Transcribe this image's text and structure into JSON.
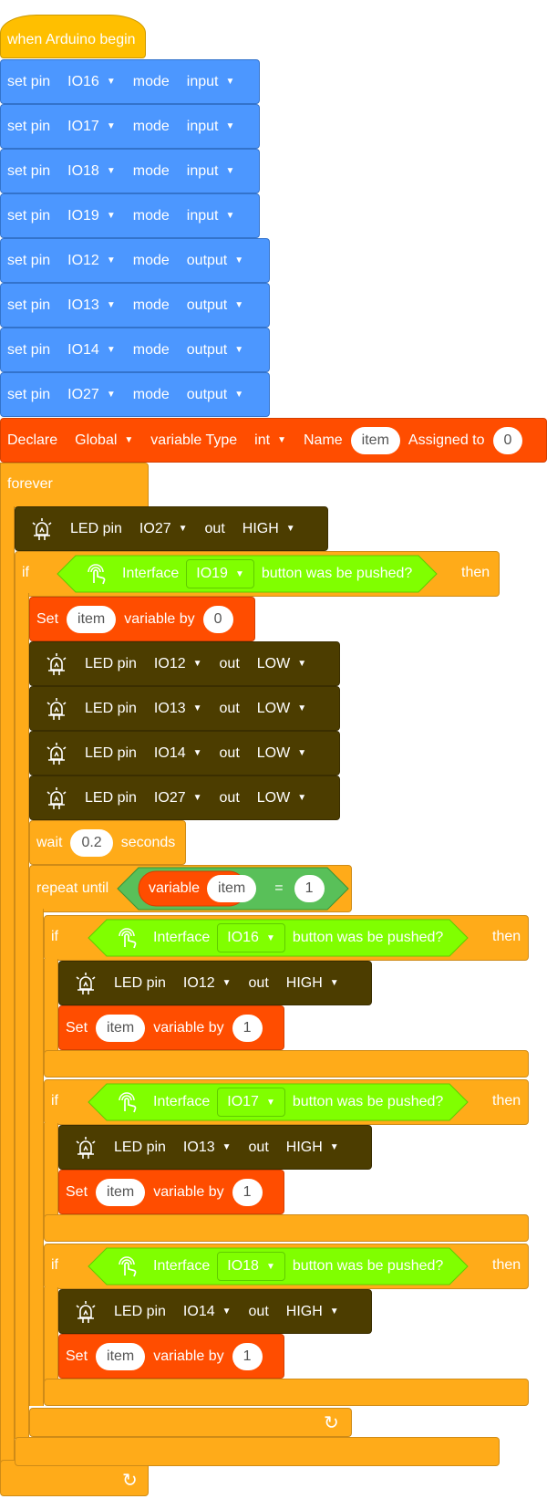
{
  "hat": {
    "label": "when Arduino begin"
  },
  "pin_modes": [
    {
      "label": "set pin",
      "pin": "IO16",
      "mode_label": "mode",
      "mode": "input"
    },
    {
      "label": "set pin",
      "pin": "IO17",
      "mode_label": "mode",
      "mode": "input"
    },
    {
      "label": "set pin",
      "pin": "IO18",
      "mode_label": "mode",
      "mode": "input"
    },
    {
      "label": "set pin",
      "pin": "IO19",
      "mode_label": "mode",
      "mode": "input"
    },
    {
      "label": "set pin",
      "pin": "IO12",
      "mode_label": "mode",
      "mode": "output"
    },
    {
      "label": "set pin",
      "pin": "IO13",
      "mode_label": "mode",
      "mode": "output"
    },
    {
      "label": "set pin",
      "pin": "IO14",
      "mode_label": "mode",
      "mode": "output"
    },
    {
      "label": "set pin",
      "pin": "IO27",
      "mode_label": "mode",
      "mode": "output"
    }
  ],
  "declare": {
    "label": "Declare",
    "scope": "Global",
    "type_label": "variable Type",
    "type": "int",
    "name_label": "Name",
    "name": "item",
    "assign_label": "Assigned to",
    "value": "0"
  },
  "forever": {
    "label": "forever"
  },
  "led_top": {
    "label": "LED pin",
    "pin": "IO27",
    "out_label": "out",
    "level": "HIGH"
  },
  "if_main": {
    "if": "if",
    "iface": "Interface",
    "pin": "IO19",
    "suffix": "button was be pushed?",
    "then": "then"
  },
  "set_main": {
    "label": "Set",
    "var": "item",
    "mid": "variable by",
    "value": "0"
  },
  "leds_low": [
    {
      "label": "LED pin",
      "pin": "IO12",
      "out_label": "out",
      "level": "LOW"
    },
    {
      "label": "LED pin",
      "pin": "IO13",
      "out_label": "out",
      "level": "LOW"
    },
    {
      "label": "LED pin",
      "pin": "IO14",
      "out_label": "out",
      "level": "LOW"
    },
    {
      "label": "LED pin",
      "pin": "IO27",
      "out_label": "out",
      "level": "LOW"
    }
  ],
  "wait": {
    "label": "wait",
    "value": "0.2",
    "unit": "seconds"
  },
  "repeat": {
    "label": "repeat until",
    "var_label": "variable",
    "var": "item",
    "op": "=",
    "value": "1"
  },
  "inner_ifs": [
    {
      "if": "if",
      "iface": "Interface",
      "pin": "IO16",
      "suffix": "button was be pushed?",
      "then": "then",
      "led": {
        "label": "LED pin",
        "pin": "IO12",
        "out_label": "out",
        "level": "HIGH"
      },
      "set": {
        "label": "Set",
        "var": "item",
        "mid": "variable by",
        "value": "1"
      }
    },
    {
      "if": "if",
      "iface": "Interface",
      "pin": "IO17",
      "suffix": "button was be pushed?",
      "then": "then",
      "led": {
        "label": "LED pin",
        "pin": "IO13",
        "out_label": "out",
        "level": "HIGH"
      },
      "set": {
        "label": "Set",
        "var": "item",
        "mid": "variable by",
        "value": "1"
      }
    },
    {
      "if": "if",
      "iface": "Interface",
      "pin": "IO18",
      "suffix": "button was be pushed?",
      "then": "then",
      "led": {
        "label": "LED pin",
        "pin": "IO14",
        "out_label": "out",
        "level": "HIGH"
      },
      "set": {
        "label": "Set",
        "var": "item",
        "mid": "variable by",
        "value": "1"
      }
    }
  ],
  "loop_icon": "loop-arrow-icon",
  "led_icon": "led-light-icon",
  "touch_icon": "touch-hand-icon"
}
